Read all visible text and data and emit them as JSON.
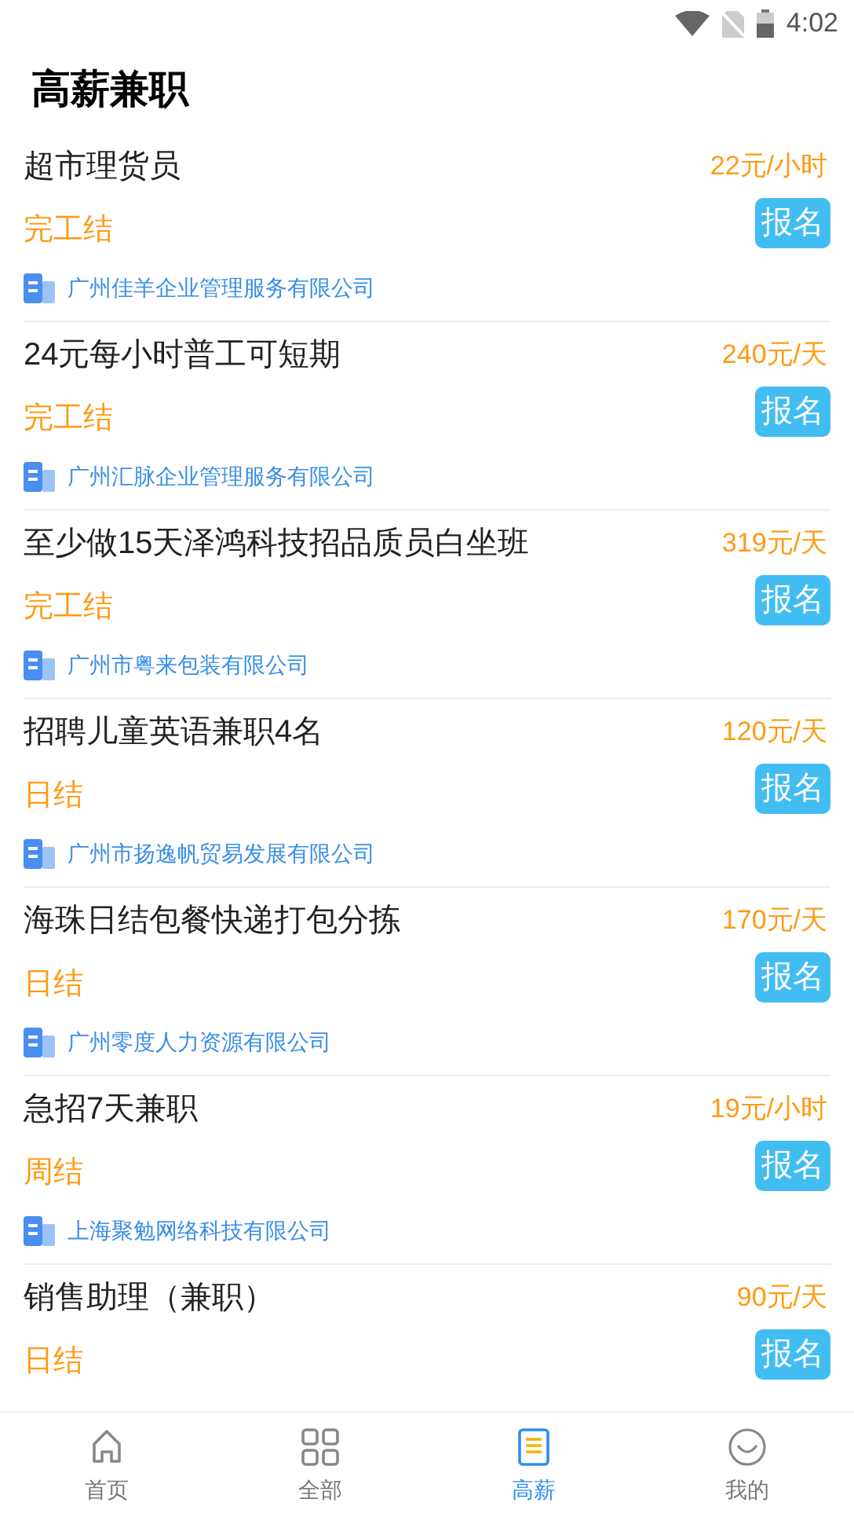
{
  "status_bar": {
    "time": "4:02"
  },
  "title": "高薪兼职",
  "jobs": [
    {
      "title": "超市理货员",
      "salary": "22元/小时",
      "settlement": "完工结",
      "button": "报名",
      "company": "广州佳羊企业管理服务有限公司"
    },
    {
      "title": "24元每小时普工可短期",
      "salary": "240元/天",
      "settlement": "完工结",
      "button": "报名",
      "company": "广州汇脉企业管理服务有限公司"
    },
    {
      "title": "至少做15天泽鸿科技招品质员白坐班",
      "salary": "319元/天",
      "settlement": "完工结",
      "button": "报名",
      "company": "广州市粤来包装有限公司"
    },
    {
      "title": "招聘儿童英语兼职4名",
      "salary": "120元/天",
      "settlement": "日结",
      "button": "报名",
      "company": "广州市扬逸帆贸易发展有限公司"
    },
    {
      "title": "海珠日结包餐快递打包分拣",
      "salary": "170元/天",
      "settlement": "日结",
      "button": "报名",
      "company": "广州零度人力资源有限公司"
    },
    {
      "title": "急招7天兼职",
      "salary": "19元/小时",
      "settlement": "周结",
      "button": "报名",
      "company": "上海聚勉网络科技有限公司"
    },
    {
      "title": "销售助理（兼职）",
      "salary": "90元/天",
      "settlement": "日结",
      "button": "报名"
    }
  ],
  "nav": [
    {
      "label": "首页",
      "kind": "home",
      "selected": false
    },
    {
      "label": "全部",
      "kind": "grid",
      "selected": false
    },
    {
      "label": "高薪",
      "kind": "doc",
      "selected": true
    },
    {
      "label": "我的",
      "kind": "smile",
      "selected": false
    }
  ]
}
